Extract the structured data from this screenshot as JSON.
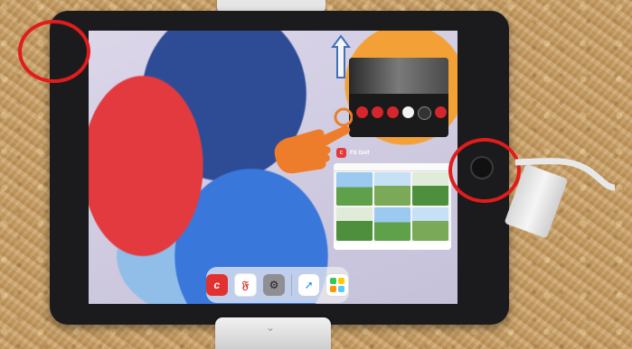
{
  "task_view": {
    "card1_title": "",
    "card2_title": "FS Golf",
    "card2_app_initial": "c"
  },
  "dock": {
    "apps": [
      {
        "name": "fs-golf-app",
        "glyph": "c"
      },
      {
        "name": "red-app",
        "glyph": "𝔉"
      },
      {
        "name": "settings-app",
        "glyph": "⚙"
      },
      {
        "name": "safari-app",
        "glyph": "➚"
      },
      {
        "name": "folder-app",
        "glyph": ""
      }
    ]
  },
  "colors": {
    "annotation_red": "#e01c1c",
    "hand_orange": "#ee7d2b",
    "arrow_blue": "#3f70b8"
  }
}
